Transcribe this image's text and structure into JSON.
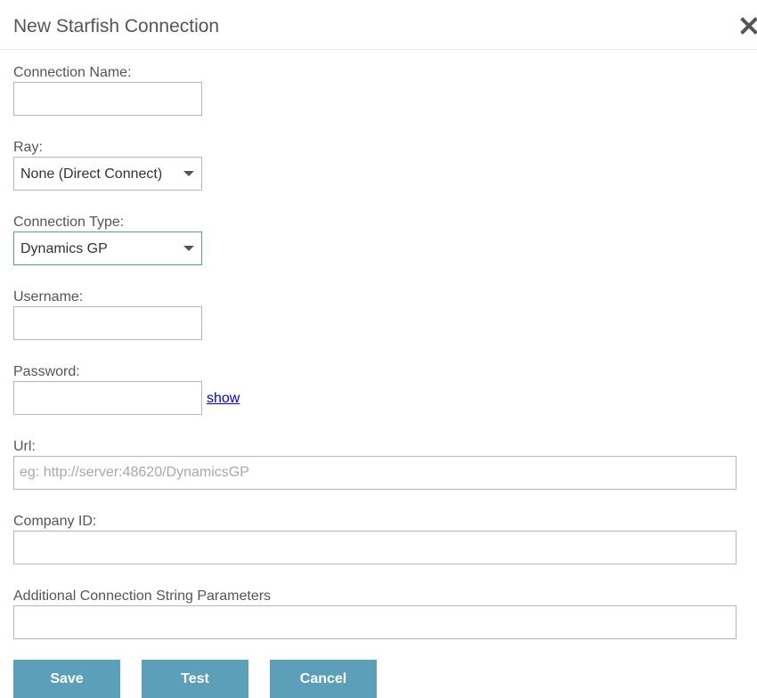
{
  "dialog": {
    "title": "New Starfish Connection",
    "close_icon": "close-icon"
  },
  "form": {
    "connection_name": {
      "label": "Connection Name:",
      "value": ""
    },
    "ray": {
      "label": "Ray:",
      "selected": "None (Direct Connect)"
    },
    "connection_type": {
      "label": "Connection Type:",
      "selected": "Dynamics GP"
    },
    "username": {
      "label": "Username:",
      "value": ""
    },
    "password": {
      "label": "Password:",
      "value": "",
      "show_label": "show"
    },
    "url": {
      "label": "Url:",
      "value": "",
      "placeholder": "eg: http://server:48620/DynamicsGP"
    },
    "company_id": {
      "label": "Company ID:",
      "value": ""
    },
    "additional_params": {
      "label": "Additional Connection String Parameters",
      "value": ""
    }
  },
  "buttons": {
    "save": "Save",
    "test": "Test",
    "cancel": "Cancel"
  },
  "colors": {
    "button_bg": "#5b9fb8",
    "focus_border": "#5b99a8",
    "link": "#0000ee"
  }
}
